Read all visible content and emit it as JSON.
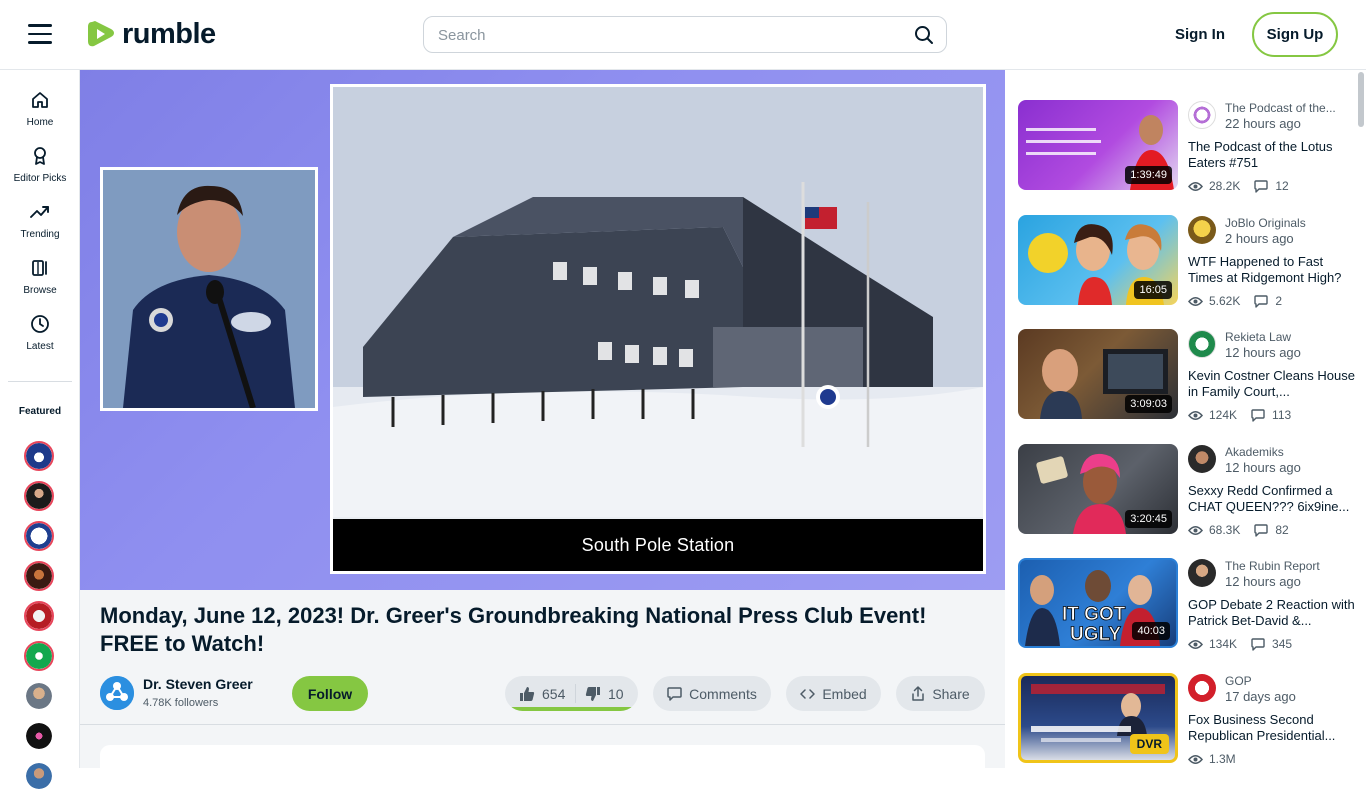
{
  "header": {
    "logo_text": "rumble",
    "search_placeholder": "Search",
    "signin_label": "Sign In",
    "signup_label": "Sign Up",
    "brand_color": "#85c742"
  },
  "leftnav": {
    "items": [
      {
        "label": "Home",
        "icon": "home-icon"
      },
      {
        "label": "Editor Picks",
        "icon": "award-icon"
      },
      {
        "label": "Trending",
        "icon": "trending-icon"
      },
      {
        "label": "Browse",
        "icon": "browse-icon"
      },
      {
        "label": "Latest",
        "icon": "clock-icon"
      }
    ],
    "featured_label": "Featured"
  },
  "video": {
    "caption": "South Pole Station",
    "title": "Monday, June 12, 2023! Dr. Greer's Groundbreaking National Press Club Event! FREE to Watch!",
    "channel": "Dr. Steven Greer",
    "followers": "4.78K followers",
    "follow_label": "Follow",
    "likes": "654",
    "dislikes": "10",
    "like_fraction": 0.985,
    "comments_label": "Comments",
    "embed_label": "Embed",
    "share_label": "Share"
  },
  "rail": {
    "items": [
      {
        "channel": "The Podcast of the...",
        "time": "22 hours ago",
        "title": "The Podcast of the Lotus Eaters #751",
        "views": "28.2K",
        "comments": "12",
        "duration": "1:39:49"
      },
      {
        "channel": "JoBlo Originals",
        "time": "2 hours ago",
        "title": "WTF Happened to Fast Times at Ridgemont High?",
        "views": "5.62K",
        "comments": "2",
        "duration": "16:05"
      },
      {
        "channel": "Rekieta Law",
        "time": "12 hours ago",
        "title": "Kevin Costner Cleans House in Family Court,...",
        "views": "124K",
        "comments": "113",
        "duration": "3:09:03"
      },
      {
        "channel": "Akademiks",
        "time": "12 hours ago",
        "title": "Sexxy Redd Confirmed a CHAT QUEEN??? 6ix9ine...",
        "views": "68.3K",
        "comments": "82",
        "duration": "3:20:45"
      },
      {
        "channel": "The Rubin Report",
        "time": "12 hours ago",
        "title": "GOP Debate 2 Reaction with Patrick Bet-David &...",
        "views": "134K",
        "comments": "345",
        "duration": "40:03"
      },
      {
        "channel": "GOP",
        "time": "17 days ago",
        "title": "Fox Business Second Republican Presidential...",
        "views": "1.3M",
        "badge": "DVR"
      }
    ]
  }
}
